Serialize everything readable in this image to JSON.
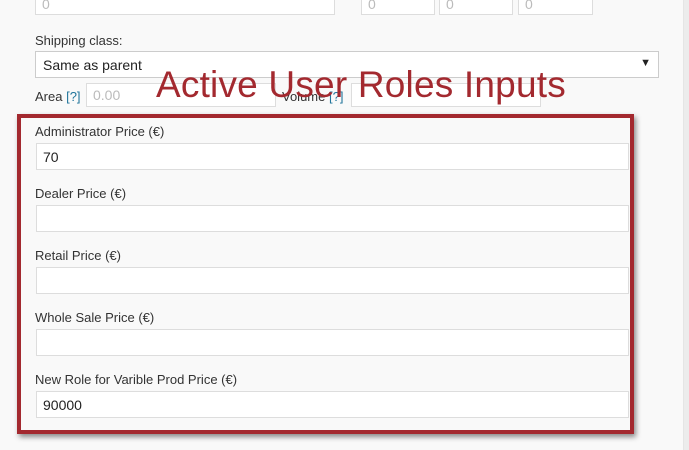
{
  "top_fields": {
    "weight_value": "0",
    "length_value": "0",
    "width_value": "0",
    "height_value": "0"
  },
  "shipping": {
    "label": "Shipping class:",
    "selected": "Same as parent"
  },
  "area": {
    "label": "Area",
    "help": "[?]",
    "placeholder": "0.00"
  },
  "volume": {
    "label": "Volume",
    "help": "[?]"
  },
  "annotation": "Active User Roles Inputs",
  "roles": [
    {
      "label": "Administrator Price (€)",
      "value": "70"
    },
    {
      "label": "Dealer Price (€)",
      "value": ""
    },
    {
      "label": "Retail Price (€)",
      "value": ""
    },
    {
      "label": "Whole Sale Price (€)",
      "value": ""
    },
    {
      "label": "New Role for Varible Prod Price (€)",
      "value": "90000"
    }
  ],
  "colors": {
    "annotation": "#a3292f",
    "help_link": "#21759b"
  },
  "icons": {
    "select_arrow": "caret-down-icon"
  }
}
